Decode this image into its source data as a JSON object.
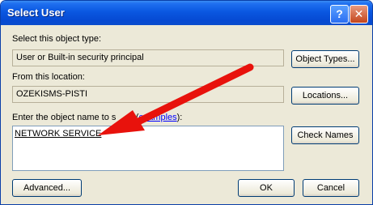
{
  "window": {
    "title": "Select User",
    "help_glyph": "?",
    "close_glyph": "✕"
  },
  "object_type": {
    "label": "Select this object type:",
    "value": "User or Built-in security principal",
    "button": "Object Types..."
  },
  "location": {
    "label": "From this location:",
    "value": "OZEKISMS-PISTI",
    "button": "Locations..."
  },
  "names": {
    "label_pre": "Enter the object name to s",
    "label_gap": "      ",
    "label_post": "t (",
    "link": "examples",
    "label_end": "):",
    "value": "NETWORK SERVICE",
    "button": "Check Names"
  },
  "footer": {
    "advanced": "Advanced...",
    "ok": "OK",
    "cancel": "Cancel"
  },
  "annotation": {
    "arrow_color": "#e8120c"
  }
}
